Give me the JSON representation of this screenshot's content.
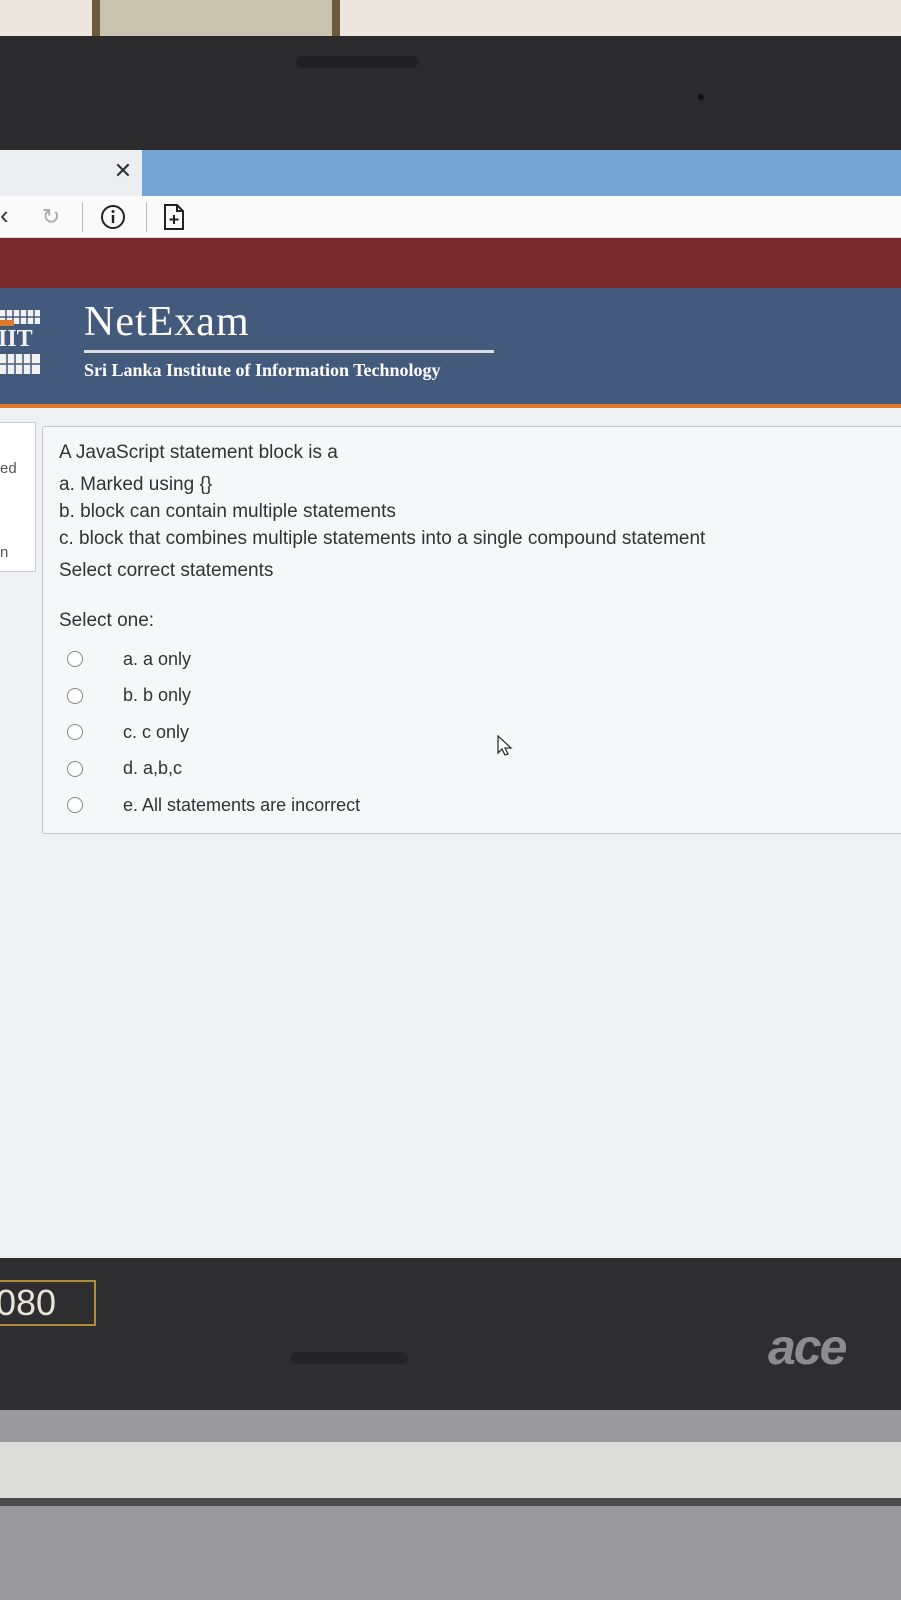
{
  "browser": {
    "tab_close_icon": "close-icon",
    "back_icon": "back-icon",
    "refresh_icon": "refresh-icon",
    "info_icon": "info-icon",
    "page_icon": "add-page-icon"
  },
  "site": {
    "title": "NetExam",
    "subtitle": "Sri Lanka Institute of Information Technology",
    "logo_text": "IIT"
  },
  "sidebar": {
    "fragment_1": "ed",
    "fragment_2": "n"
  },
  "question": {
    "intro": "A JavaScript statement block is a",
    "statements": [
      "a. Marked using {}",
      "b. block can contain multiple statements",
      "c. block that combines multiple statements into a single compound statement"
    ],
    "prompt": "Select correct statements",
    "select_label": "Select one:",
    "options": [
      "a. a only",
      "b. b only",
      "c. c only",
      "d. a,b,c",
      "e. All statements are incorrect"
    ]
  },
  "laptop": {
    "resolution_badge": "080",
    "brand": "ace"
  },
  "colors": {
    "header_bg": "#445a7c",
    "maroon_band": "#7b2a2d",
    "accent_orange": "#e07a2a",
    "tab_blue": "#78a6d4"
  }
}
